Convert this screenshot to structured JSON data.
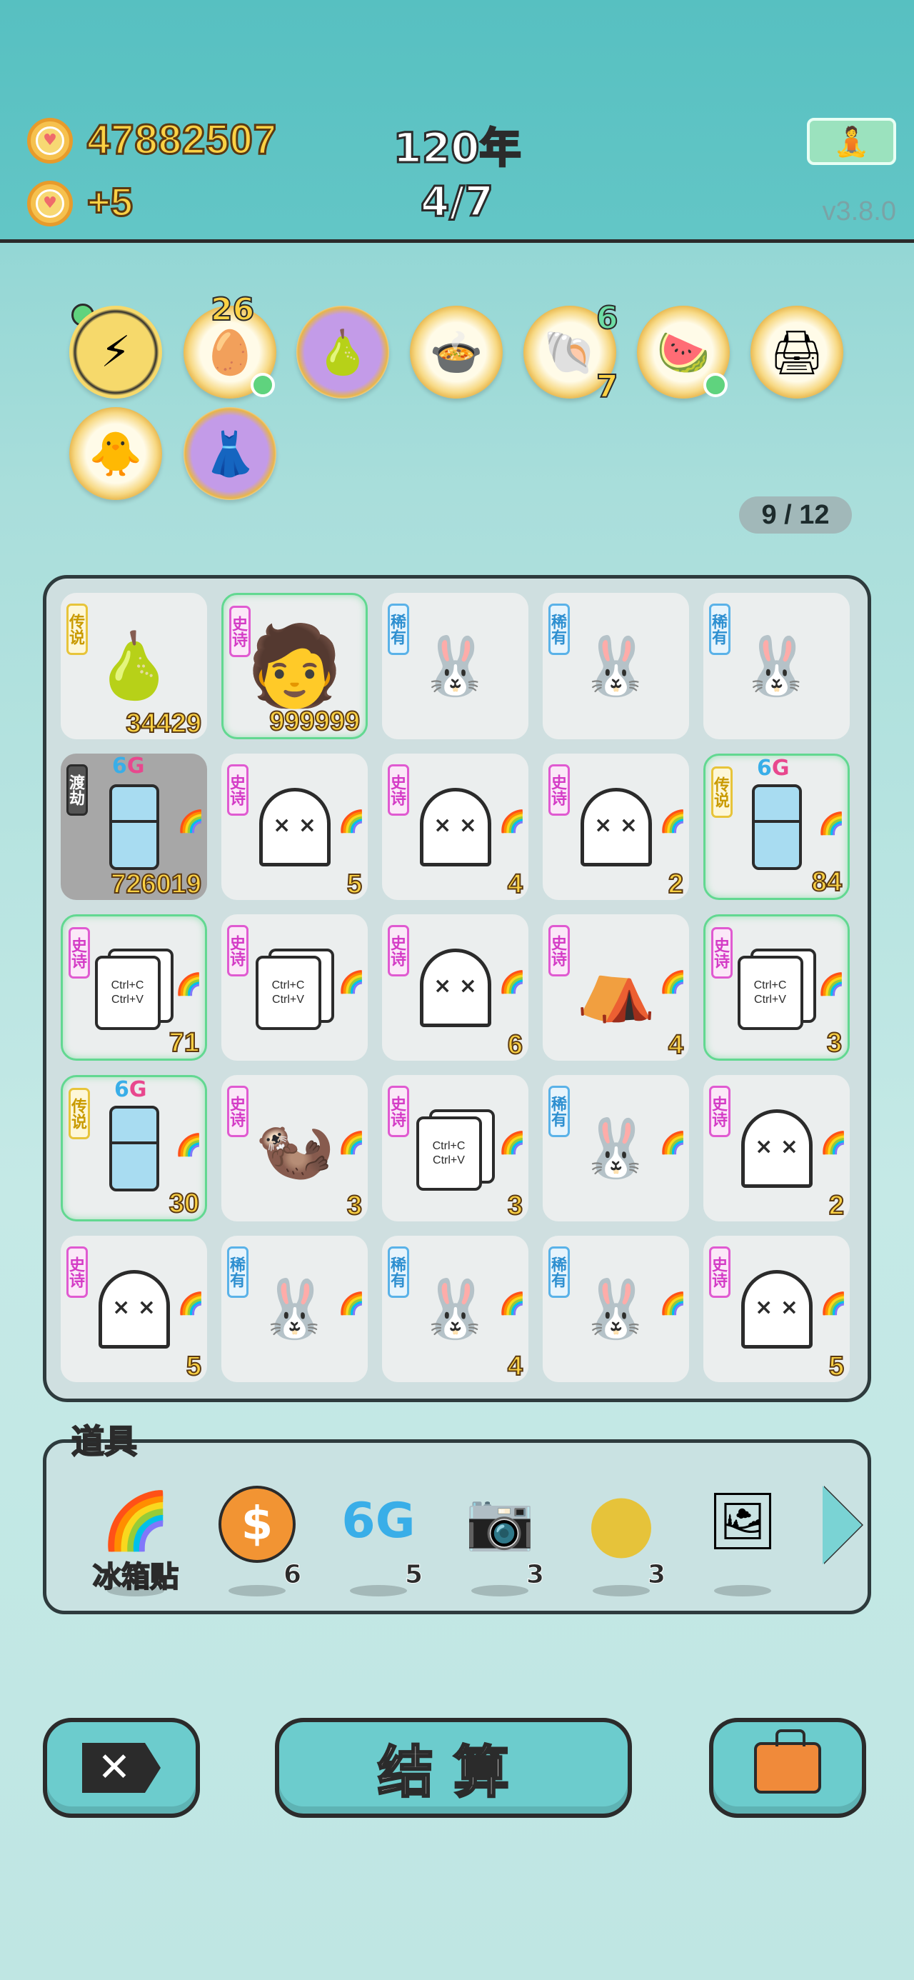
{
  "header": {
    "coins": "47882507",
    "income": "+5",
    "year": "120年",
    "round": "4/7",
    "version": "v3.8.0"
  },
  "buffs": [
    {
      "name": "lightning-icon",
      "glyph": "⚡"
    },
    {
      "name": "egg-tray-icon",
      "glyph": "🥚",
      "count": "26"
    },
    {
      "name": "sunglasses-pear-icon",
      "glyph": "🍐"
    },
    {
      "name": "pot-duck-icon",
      "glyph": "🍲"
    },
    {
      "name": "shell-icon",
      "glyph": "🐚",
      "count_top": "6",
      "count_bottom": "7"
    },
    {
      "name": "fruit-bowl-icon",
      "glyph": "🍉"
    },
    {
      "name": "printer-icon",
      "glyph": "🖨"
    },
    {
      "name": "chick-egg-icon",
      "glyph": "🐥"
    },
    {
      "name": "skirt-icon",
      "glyph": "👗"
    }
  ],
  "progress": "9 / 12",
  "board": {
    "rows": [
      [
        {
          "tag": "传说",
          "rarity": "leg",
          "icon": "pear-crown",
          "count": "34429"
        },
        {
          "tag": "史诗",
          "rarity": "epic",
          "icon": "face",
          "count": "999999",
          "glow": true
        },
        {
          "tag": "稀有",
          "rarity": "rare",
          "icon": "bunny",
          "count": ""
        },
        {
          "tag": "稀有",
          "rarity": "rare",
          "icon": "bunny",
          "count": ""
        },
        {
          "tag": "稀有",
          "rarity": "rare",
          "icon": "bunny",
          "count": ""
        }
      ],
      [
        {
          "tag": "渡劫",
          "rarity": "tri",
          "icon": "fridge",
          "count": "726019",
          "dark": true
        },
        {
          "tag": "史诗",
          "rarity": "epic",
          "icon": "ghost",
          "count": "5"
        },
        {
          "tag": "史诗",
          "rarity": "epic",
          "icon": "ghost",
          "count": "4"
        },
        {
          "tag": "史诗",
          "rarity": "epic",
          "icon": "ghost",
          "count": "2"
        },
        {
          "tag": "传说",
          "rarity": "leg",
          "icon": "fridge",
          "count": "84",
          "glow": true
        }
      ],
      [
        {
          "tag": "史诗",
          "rarity": "epic",
          "icon": "cards",
          "count": "71",
          "glow": true
        },
        {
          "tag": "史诗",
          "rarity": "epic",
          "icon": "cards",
          "count": ""
        },
        {
          "tag": "史诗",
          "rarity": "epic",
          "icon": "ghost",
          "count": "6"
        },
        {
          "tag": "史诗",
          "rarity": "epic",
          "icon": "tent",
          "count": "4"
        },
        {
          "tag": "史诗",
          "rarity": "epic",
          "icon": "cards",
          "count": "3",
          "glow": true
        }
      ],
      [
        {
          "tag": "传说",
          "rarity": "leg",
          "icon": "fridge",
          "count": "30",
          "glow": true
        },
        {
          "tag": "史诗",
          "rarity": "epic",
          "icon": "otter",
          "count": "3"
        },
        {
          "tag": "史诗",
          "rarity": "epic",
          "icon": "cards",
          "count": "3"
        },
        {
          "tag": "稀有",
          "rarity": "rare",
          "icon": "bunny",
          "count": ""
        },
        {
          "tag": "史诗",
          "rarity": "epic",
          "icon": "ghost",
          "count": "2"
        }
      ],
      [
        {
          "tag": "史诗",
          "rarity": "epic",
          "icon": "ghost",
          "count": "5"
        },
        {
          "tag": "稀有",
          "rarity": "rare",
          "icon": "bunny",
          "count": ""
        },
        {
          "tag": "稀有",
          "rarity": "rare",
          "icon": "bunny",
          "count": "4"
        },
        {
          "tag": "稀有",
          "rarity": "rare",
          "icon": "bunny",
          "count": ""
        },
        {
          "tag": "史诗",
          "rarity": "epic",
          "icon": "ghost",
          "count": "5"
        }
      ]
    ],
    "cards_text": [
      "Ctrl+C",
      "Ctrl+V"
    ],
    "badge_6g": [
      "6",
      "G"
    ]
  },
  "items": {
    "title": "道具",
    "list": [
      {
        "name": "rainbow-sticker",
        "glyph": "🌈",
        "label": "冰箱贴",
        "count": ""
      },
      {
        "name": "coin",
        "glyph": "$",
        "label": "",
        "count": "6"
      },
      {
        "name": "6g",
        "glyph": "6G",
        "label": "",
        "count": "5"
      },
      {
        "name": "camera",
        "glyph": "📷",
        "label": "",
        "count": "3"
      },
      {
        "name": "gold-ball",
        "glyph": "●",
        "label": "",
        "count": "3"
      },
      {
        "name": "framed-fridge",
        "glyph": "🖼",
        "label": "",
        "count": ""
      }
    ]
  },
  "buttons": {
    "close": "✕",
    "settle": "结算"
  }
}
